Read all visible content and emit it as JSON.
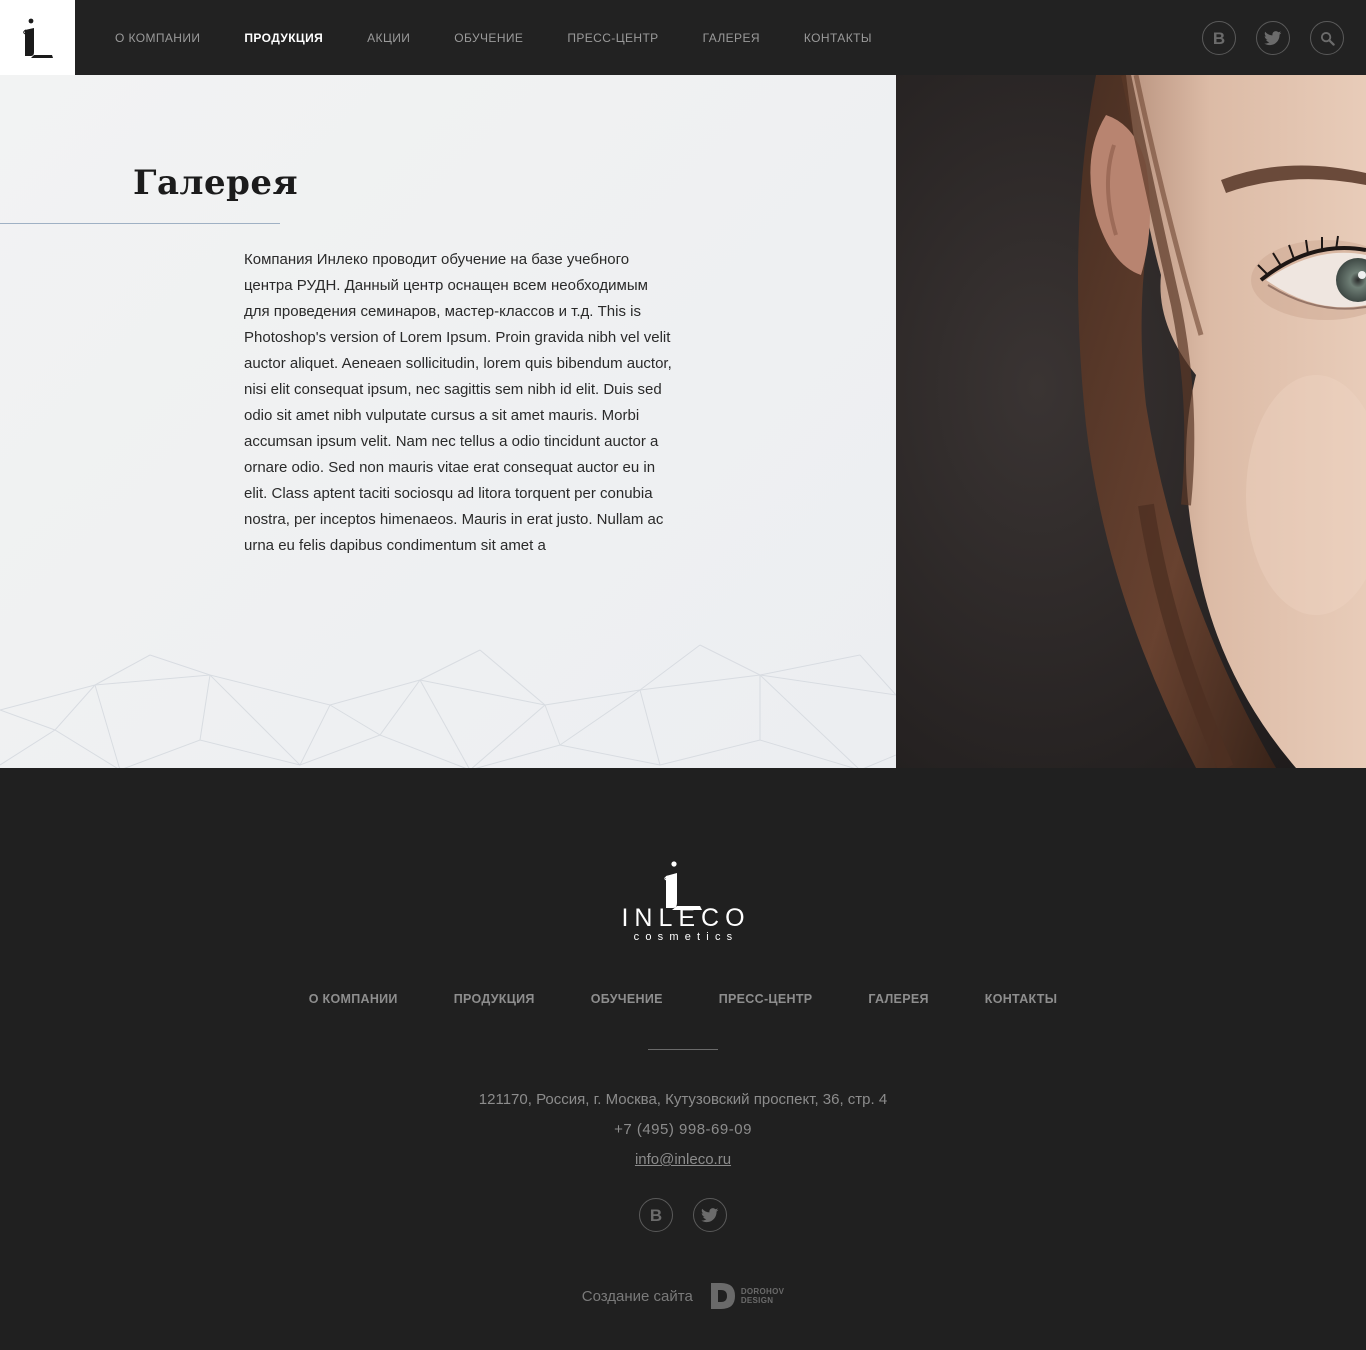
{
  "brand": {
    "logo_alt": "iL",
    "name": "INLECO",
    "sub": "cosmetics"
  },
  "header": {
    "nav": [
      {
        "label": "О компании"
      },
      {
        "label": "Продукция"
      },
      {
        "label": "Акции"
      },
      {
        "label": "Обучение"
      },
      {
        "label": "Пресс-центр"
      },
      {
        "label": "Галерея"
      },
      {
        "label": "Контакты"
      }
    ],
    "active_index": 1,
    "icons": [
      "vk-icon",
      "twitter-icon",
      "search-icon"
    ]
  },
  "hero": {
    "title": "Галерея",
    "text": "Компания Инлеко проводит обучение на базе учебного центра РУДН. Данный центр оснащен всем необходимым для проведения семинаров, мастер-классов и т.д. This is Photoshop's version  of Lorem Ipsum. Proin gravida nibh vel velit auctor aliquet. Aeneaen sollicitudin, lorem quis bibendum auctor, nisi elit consequat ipsum, nec sagittis sem nibh id elit. Duis sed odio sit amet nibh vulputate cursus a sit amet mauris. Morbi accumsan ipsum velit. Nam nec tellus a odio tincidunt auctor a ornare odio. Sed non  mauris vitae erat consequat auctor eu in elit. Class aptent taciti sociosqu ad litora torquent per conubia nostra, per inceptos himenaeos. Mauris in erat justo. Nullam ac urna eu felis dapibus condimentum sit amet a"
  },
  "footer": {
    "nav": [
      {
        "label": "О компании"
      },
      {
        "label": "Продукция"
      },
      {
        "label": "Обучение"
      },
      {
        "label": "Пресс-центр"
      },
      {
        "label": "Галерея"
      },
      {
        "label": "Контакты"
      }
    ],
    "address": "121170, Россия, г. Москва, Кутузовский проспект, 36, стр. 4",
    "phone": "+7 (495) 998-69-09",
    "email": "info@inleco.ru",
    "credit_text": "Создание сайта",
    "credit_brand_line1": "DOROHOV",
    "credit_brand_line2": "DESIGN"
  },
  "colors": {
    "header_bg": "#222222",
    "footer_bg": "#202020",
    "hero_bg": "#f0f1f2",
    "accent_line": "#9fb1c4"
  }
}
